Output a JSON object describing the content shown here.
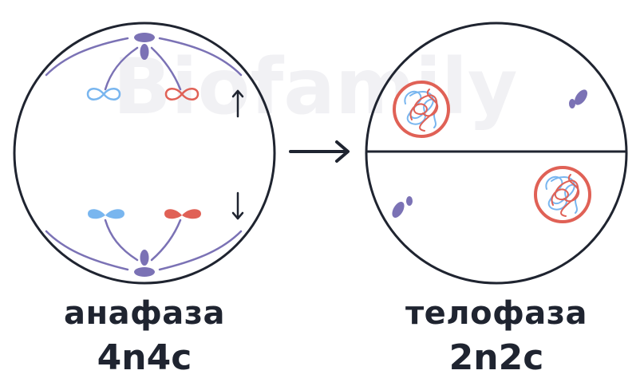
{
  "watermark": "Biofamily",
  "anaphase": {
    "name": "анафаза",
    "formula": "4n4c"
  },
  "telophase": {
    "name": "телофаза",
    "formula": "2n2c"
  },
  "colors": {
    "outline": "#1f2430",
    "spindle": "#7b72b5",
    "centrosome": "#7b72b5",
    "chromosome_blue": "#79b6ef",
    "chromosome_red": "#e06156",
    "nucleus_ring": "#e06156",
    "watermark": "#f1f1f4"
  },
  "icons": {
    "transition": "arrow-right-icon",
    "movement_up": "arrow-up-icon",
    "movement_down": "arrow-down-icon"
  }
}
